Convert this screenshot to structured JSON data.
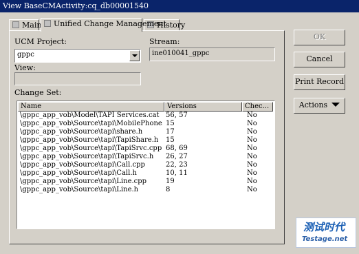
{
  "window": {
    "title": "View BaseCMActivity:cq_db00001540"
  },
  "tabs": [
    {
      "label": "Main",
      "active": false
    },
    {
      "label": "Unified Change Management",
      "active": true
    },
    {
      "label": "History",
      "active": false
    }
  ],
  "form": {
    "ucm_project_label": "UCM Project:",
    "ucm_project_value": "gppc",
    "stream_label": "Stream:",
    "stream_value": "ine010041_gppc",
    "view_label": "View:",
    "view_value": "",
    "change_set_label": "Change Set:"
  },
  "change_set": {
    "columns": [
      "Name",
      "Versions",
      "Chec..."
    ],
    "rows": [
      [
        "\\gppc_app_vob\\Model\\TAPI Services.cat",
        "56, 57",
        "No"
      ],
      [
        "\\gppc_app_vob\\Source\\tapi\\MobilePhone.h",
        "15",
        "No"
      ],
      [
        "\\gppc_app_vob\\Source\\tapi\\share.h",
        "17",
        "No"
      ],
      [
        "\\gppc_app_vob\\Source\\tapi\\TapiShare.h",
        "15",
        "No"
      ],
      [
        "\\gppc_app_vob\\Source\\tapi\\TapiSrvc.cpp",
        "68, 69",
        "No"
      ],
      [
        "\\gppc_app_vob\\Source\\tapi\\TapiSrvc.h",
        "26, 27",
        "No"
      ],
      [
        "\\gppc_app_vob\\Source\\tapi\\Call.cpp",
        "22, 23",
        "No"
      ],
      [
        "\\gppc_app_vob\\Source\\tapi\\Call.h",
        "10, 11",
        "No"
      ],
      [
        "\\gppc_app_vob\\Source\\tapi\\Line.cpp",
        "19",
        "No"
      ],
      [
        "\\gppc_app_vob\\Source\\tapi\\Line.h",
        "8",
        "No"
      ]
    ]
  },
  "buttons": {
    "ok": "OK",
    "cancel": "Cancel",
    "print_record": "Print Record",
    "actions": "Actions"
  },
  "watermark": {
    "cn": "测试时代",
    "en": "Testage.net"
  },
  "colors": {
    "title_bar": "#0a246a",
    "face": "#d4d0c8",
    "field": "#ffffff"
  }
}
